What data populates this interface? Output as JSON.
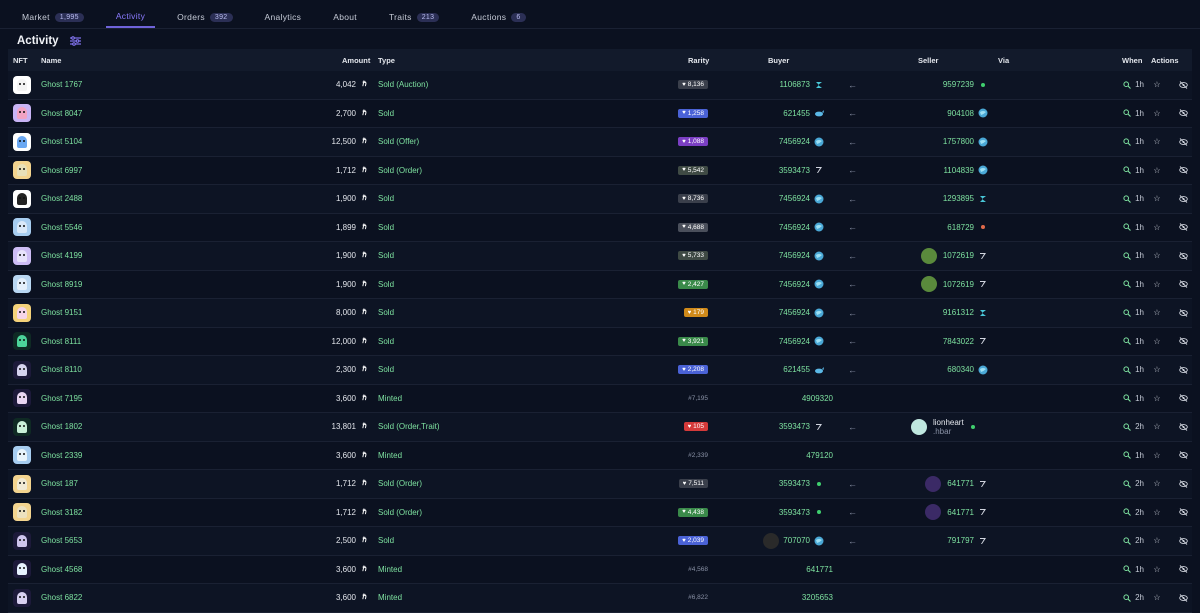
{
  "tabs": [
    {
      "label": "Market",
      "count": "1,995"
    },
    {
      "label": "Activity",
      "count": ""
    },
    {
      "label": "Orders",
      "count": "392"
    },
    {
      "label": "Analytics",
      "count": ""
    },
    {
      "label": "About",
      "count": ""
    },
    {
      "label": "Traits",
      "count": "213"
    },
    {
      "label": "Auctions",
      "count": "6"
    }
  ],
  "page_title": "Activity",
  "columns": {
    "nft": "NFT",
    "name": "Name",
    "amount": "Amount",
    "type": "Type",
    "rarity": "Rarity",
    "buyer": "Buyer",
    "seller": "Seller",
    "via": "Via",
    "when": "When",
    "actions": "Actions"
  },
  "colors": {
    "accent": "#6f63d9",
    "green": "#7ee2a0"
  },
  "rows": [
    {
      "name": "Ghost 1767",
      "amount": "4,042",
      "type": "Sold (Auction)",
      "rarity": "8,136",
      "rarity_color": "#3a3f4b",
      "buyer": "1106873",
      "buyer_icon": "hashpack",
      "seller": "9597239",
      "seller_icon": "dot-green",
      "when": "1h",
      "ghost": "#f4f4f4",
      "bg": "#ffffff"
    },
    {
      "name": "Ghost 8047",
      "amount": "2,700",
      "type": "Sold",
      "rarity": "1,258",
      "rarity_color": "#4a62d6",
      "buyer": "621455",
      "buyer_icon": "whale",
      "seller": "904108",
      "seller_icon": "globe",
      "when": "1h",
      "ghost": "#f2a3c3",
      "bg": "#c9b4f5"
    },
    {
      "name": "Ghost 5104",
      "amount": "12,500",
      "type": "Sold (Offer)",
      "rarity": "1,088",
      "rarity_color": "#7b3fc4",
      "buyer": "7456924",
      "buyer_icon": "globe",
      "seller": "1757800",
      "seller_icon": "globe",
      "when": "1h",
      "ghost": "#6ba8f2",
      "bg": "#ffffff"
    },
    {
      "name": "Ghost 6997",
      "amount": "1,712",
      "type": "Sold (Order)",
      "rarity": "5,542",
      "rarity_color": "#3f4a44",
      "buyer": "3593473",
      "buyer_icon": "blade",
      "seller": "1104839",
      "seller_icon": "globe",
      "when": "1h",
      "ghost": "#e8e0b8",
      "bg": "#f3d48f"
    },
    {
      "name": "Ghost 2488",
      "amount": "1,900",
      "type": "Sold",
      "rarity": "8,736",
      "rarity_color": "#3a3f4b",
      "buyer": "7456924",
      "buyer_icon": "globe",
      "seller": "1293895",
      "seller_icon": "hashpack",
      "when": "1h",
      "ghost": "#222222",
      "bg": "#ffffff"
    },
    {
      "name": "Ghost 5546",
      "amount": "1,899",
      "type": "Sold",
      "rarity": "4,688",
      "rarity_color": "#4a4f5b",
      "buyer": "7456924",
      "buyer_icon": "globe",
      "seller": "618729",
      "seller_icon": "dot-red",
      "when": "1h",
      "ghost": "#d9e8f8",
      "bg": "#a7cdf0"
    },
    {
      "name": "Ghost 4199",
      "amount": "1,900",
      "type": "Sold",
      "rarity": "5,733",
      "rarity_color": "#3f4a44",
      "buyer": "7456924",
      "buyer_icon": "globe",
      "seller": "1072619",
      "seller_icon": "blade",
      "seller_pfp": "#5a8a3c",
      "when": "1h",
      "ghost": "#e7e2fb",
      "bg": "#cdbdf5"
    },
    {
      "name": "Ghost 8919",
      "amount": "1,900",
      "type": "Sold",
      "rarity": "2,427",
      "rarity_color": "#3a8a4a",
      "buyer": "7456924",
      "buyer_icon": "globe",
      "seller": "1072619",
      "seller_icon": "blade",
      "seller_pfp": "#5a8a3c",
      "when": "1h",
      "ghost": "#e4f0fb",
      "bg": "#b9d7f2"
    },
    {
      "name": "Ghost 9151",
      "amount": "8,000",
      "type": "Sold",
      "rarity": "179",
      "rarity_color": "#d08a1a",
      "buyer": "7456924",
      "buyer_icon": "globe",
      "seller": "9161312",
      "seller_icon": "hashpack",
      "when": "1h",
      "ghost": "#f5d5e9",
      "bg": "#f4d27a"
    },
    {
      "name": "Ghost 8111",
      "amount": "12,000",
      "type": "Sold",
      "rarity": "3,921",
      "rarity_color": "#3a8a4a",
      "buyer": "7456924",
      "buyer_icon": "globe",
      "seller": "7843022",
      "seller_icon": "blade",
      "when": "1h",
      "ghost": "#4cd49a",
      "bg": "#0f2a24"
    },
    {
      "name": "Ghost 8110",
      "amount": "2,300",
      "type": "Sold",
      "rarity": "2,208",
      "rarity_color": "#4a62d6",
      "buyer": "621455",
      "buyer_icon": "whale",
      "seller": "680340",
      "seller_icon": "globe",
      "when": "1h",
      "ghost": "#d6d3ef",
      "bg": "#1d1a3a"
    },
    {
      "name": "Ghost 7195",
      "amount": "3,600",
      "type": "Minted",
      "mint": "#7,195",
      "buyer": "4909320",
      "when": "1h",
      "ghost": "#e9d6f2",
      "bg": "#1d1a3a"
    },
    {
      "name": "Ghost 1802",
      "amount": "13,801",
      "type": "Sold (Order,Trait)",
      "rarity": "105",
      "rarity_color": "#d43a3a",
      "buyer": "3593473",
      "buyer_icon": "blade",
      "seller": "lionheart",
      "seller_sub": ".hbar",
      "seller_icon": "dot-green",
      "seller_pfp": "#bfe7df",
      "when": "2h",
      "ghost": "#c8f0d8",
      "bg": "#0f2a24"
    },
    {
      "name": "Ghost 2339",
      "amount": "3,600",
      "type": "Minted",
      "mint": "#2,339",
      "buyer": "479120",
      "when": "1h",
      "ghost": "#e8f4fb",
      "bg": "#a7cdf0"
    },
    {
      "name": "Ghost 187",
      "amount": "1,712",
      "type": "Sold (Order)",
      "rarity": "7,511",
      "rarity_color": "#3a3f4b",
      "buyer": "3593473",
      "buyer_icon": "dot-green",
      "seller": "641771",
      "seller_icon": "blade",
      "seller_pfp": "#3b2a66",
      "when": "2h",
      "ghost": "#f1ead4",
      "bg": "#f3d48f"
    },
    {
      "name": "Ghost 3182",
      "amount": "1,712",
      "type": "Sold (Order)",
      "rarity": "4,438",
      "rarity_color": "#3a8a4a",
      "buyer": "3593473",
      "buyer_icon": "dot-green",
      "seller": "641771",
      "seller_icon": "blade",
      "seller_pfp": "#3b2a66",
      "when": "2h",
      "ghost": "#ede1c0",
      "bg": "#f3d48f"
    },
    {
      "name": "Ghost 5653",
      "amount": "2,500",
      "type": "Sold",
      "rarity": "2,039",
      "rarity_color": "#4a62d6",
      "buyer": "707070",
      "buyer_icon": "globe",
      "buyer_pfp": "#2a2a2a",
      "seller": "791797",
      "seller_icon": "blade",
      "when": "2h",
      "ghost": "#cfc5ee",
      "bg": "#1d1a3a"
    },
    {
      "name": "Ghost 4568",
      "amount": "3,600",
      "type": "Minted",
      "mint": "#4,568",
      "buyer": "641771",
      "when": "1h",
      "ghost": "#e7f3ff",
      "bg": "#1d1a3a"
    },
    {
      "name": "Ghost 6822",
      "amount": "3,600",
      "type": "Minted",
      "mint": "#6,822",
      "buyer": "3205653",
      "when": "2h",
      "ghost": "#d8d0f0",
      "bg": "#1d1a3a"
    }
  ]
}
